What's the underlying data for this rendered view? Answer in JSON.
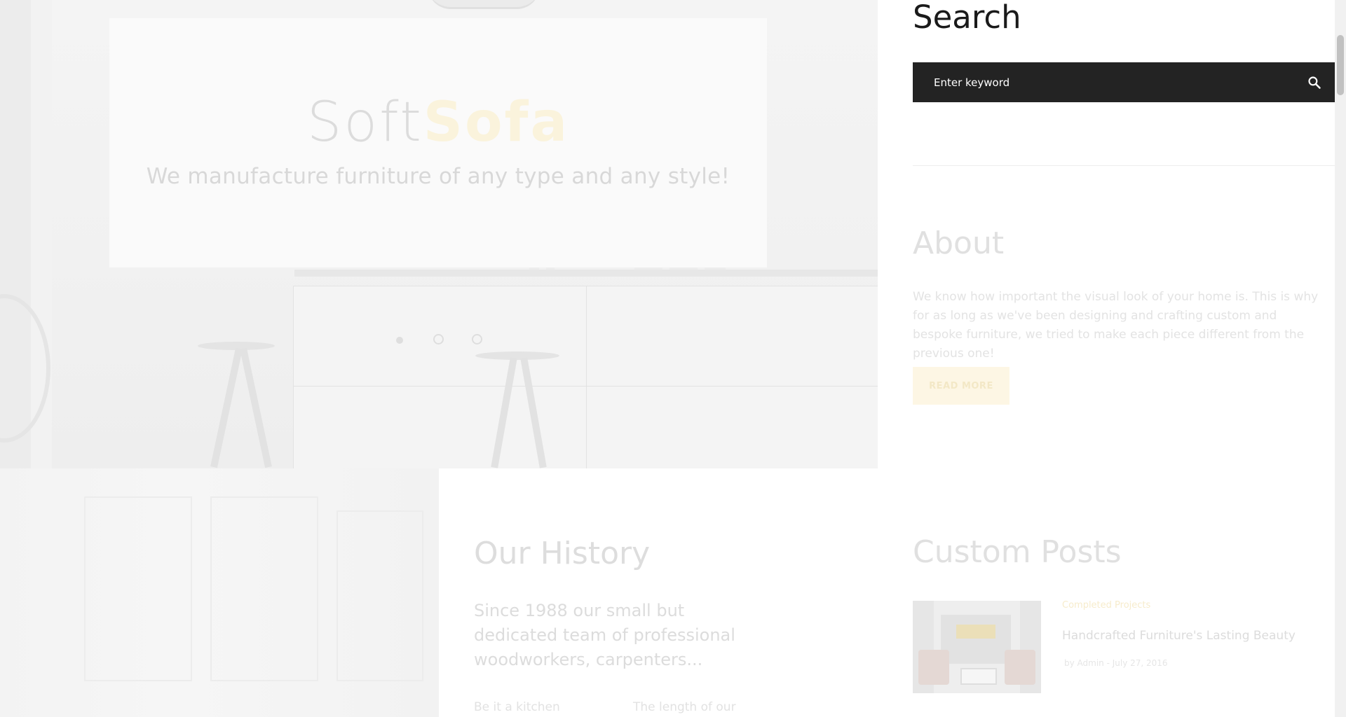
{
  "hero": {
    "brand_part1": "Soft",
    "brand_part2": "Sofa",
    "tagline": "We manufacture furniture of any type and any style!",
    "slider_dots": 3,
    "active_slide": 1
  },
  "history": {
    "title": "Our History",
    "text": "Since 1988 our small but dedicated team of professional woodworkers, carpenters...",
    "col1": "Be it a kitchen",
    "col2": "The length of our"
  },
  "sidebar": {
    "search": {
      "title": "Search",
      "placeholder": "Enter keyword"
    },
    "about": {
      "title": "About",
      "text": "We know how important the visual look of your home is. This is why for as long as we've been designing and crafting custom and bespoke furniture, we tried to make each piece different from the previous one!",
      "button": "READ MORE"
    },
    "custom_posts": {
      "title": "Custom Posts",
      "posts": [
        {
          "category": "Completed Projects",
          "title": "Handcrafted Furniture's Lasting Beauty",
          "meta": "by Admin - July 27, 2016"
        }
      ]
    }
  },
  "colors": {
    "search_bg": "#232323",
    "accent": "#f5c842",
    "text_dark": "#1a1a1a"
  },
  "icons": {
    "search": "search-icon"
  }
}
